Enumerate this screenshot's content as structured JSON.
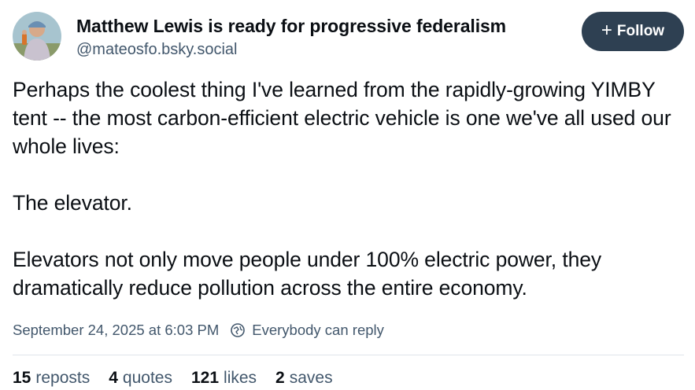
{
  "author": {
    "display_name": "Matthew Lewis is ready for progressive federalism",
    "handle": "@mateosfo.bsky.social"
  },
  "follow_button": {
    "label": "Follow"
  },
  "post": {
    "paragraphs": [
      "Perhaps the coolest thing I've learned from the rapidly-growing YIMBY tent -- the most carbon-efficient electric vehicle is one we've all used our whole lives:",
      "The elevator.",
      "Elevators not only move people under 100% electric power, they dramatically reduce pollution across the entire economy."
    ],
    "timestamp": "September 24, 2025 at 6:03 PM",
    "reply_setting": "Everybody can reply"
  },
  "stats": {
    "reposts": {
      "count": "15",
      "label": "reposts"
    },
    "quotes": {
      "count": "4",
      "label": "quotes"
    },
    "likes": {
      "count": "121",
      "label": "likes"
    },
    "saves": {
      "count": "2",
      "label": "saves"
    }
  }
}
